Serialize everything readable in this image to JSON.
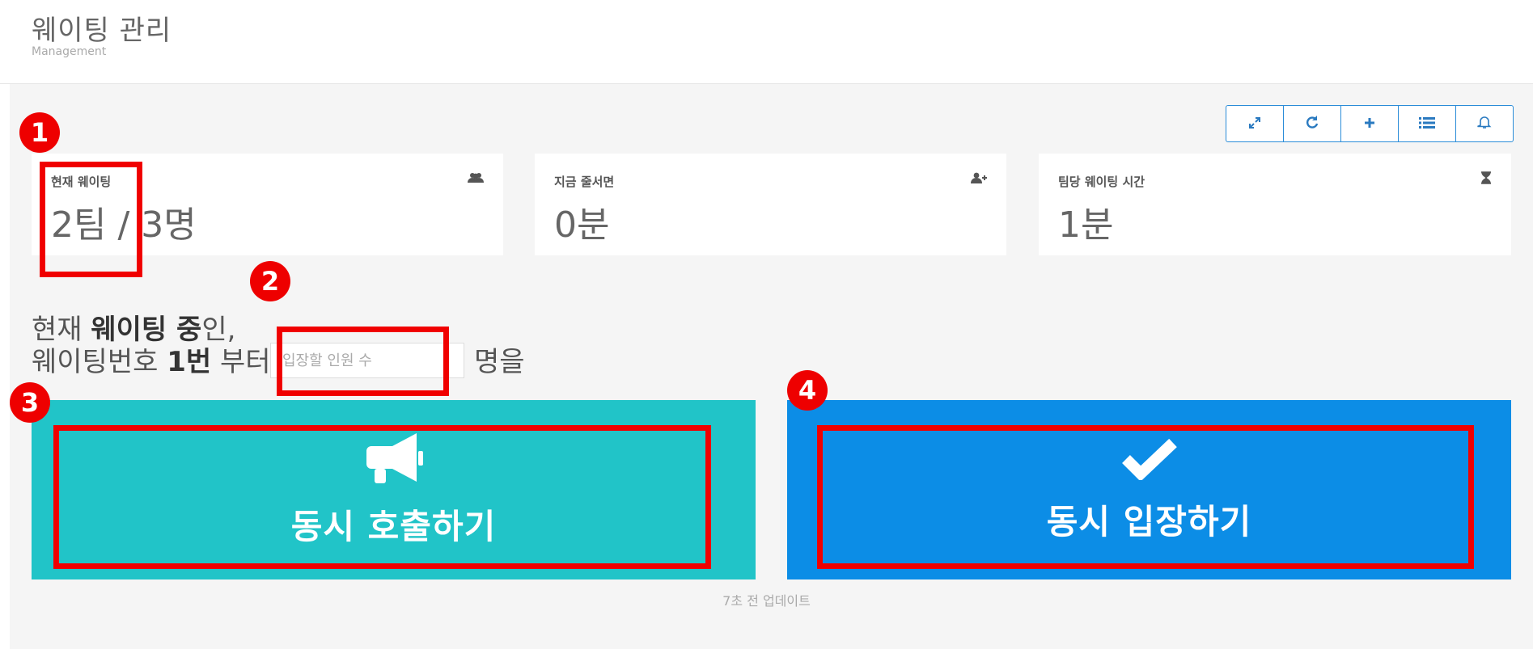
{
  "header": {
    "title": "웨이팅 관리",
    "subtitle": "Management"
  },
  "toolbar": {
    "buttons": [
      {
        "icon": "expand-icon",
        "glyph": "⤢"
      },
      {
        "icon": "refresh-icon",
        "glyph": "⟳"
      },
      {
        "icon": "plus-icon",
        "glyph": "+"
      },
      {
        "icon": "list-icon",
        "glyph": "☰"
      },
      {
        "icon": "bell-icon",
        "glyph": "🔔"
      }
    ]
  },
  "stats": [
    {
      "label": "현재 웨이팅",
      "value": "2팀 / 3명",
      "icon": "users-icon"
    },
    {
      "label": "지금 줄서면",
      "value": "0분",
      "icon": "user-plus-icon"
    },
    {
      "label": "팀당 웨이팅 시간",
      "value": "1분",
      "icon": "hourglass-icon"
    }
  ],
  "prompt": {
    "line1_prefix": "현재 ",
    "line1_bold": "웨이팅 중",
    "line1_suffix": "인,",
    "line2_prefix": "웨이팅번호 ",
    "line2_bold": "1번",
    "line2_suffix": " 부터",
    "input_placeholder": "입장할 인원 수",
    "after_input": "명을"
  },
  "actions": {
    "call_label": "동시 호출하기",
    "call_icon": "megaphone-icon",
    "enter_label": "동시 입장하기",
    "enter_icon": "check-icon"
  },
  "update_text": "7초 전 업데이트",
  "colors": {
    "call": "#21c4c8",
    "enter": "#0c8de6",
    "highlight": "#f00000"
  },
  "annotations": [
    "1",
    "2",
    "3",
    "4"
  ]
}
